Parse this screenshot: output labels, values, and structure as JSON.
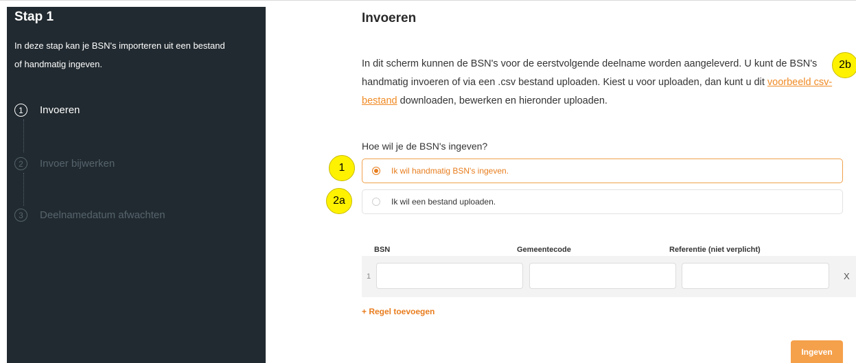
{
  "sidebar": {
    "title": "Stap 1",
    "desc_line1": "In deze stap kan je BSN's importeren uit een bestand",
    "desc_line2": "of handmatig ingeven.",
    "steps": [
      {
        "num": "1",
        "label": "Invoeren",
        "state": "active"
      },
      {
        "num": "2",
        "label": "Invoer bijwerken",
        "state": "inactive"
      },
      {
        "num": "3",
        "label": "Deelnamedatum afwachten",
        "state": "inactive"
      }
    ]
  },
  "main": {
    "title": "Invoeren",
    "intro_part1": "In dit scherm kunnen de BSN's voor de eerstvolgende deelname worden aangeleverd. U kunt de BSN's handmatig invoeren of via een .csv bestand uploaden. Kiest u voor uploaden, dan kunt u dit ",
    "intro_link": "voorbeeld csv-bestand",
    "intro_part2": " downloaden, bewerken en hieronder uploaden.",
    "question": "Hoe wil je de BSN's ingeven?",
    "options": [
      {
        "label": "Ik wil handmatig BSN's ingeven.",
        "selected": true
      },
      {
        "label": "Ik wil een bestand uploaden.",
        "selected": false
      }
    ],
    "table": {
      "headers": [
        "BSN",
        "Gemeentecode",
        "Referentie (niet verplicht)"
      ],
      "rows": [
        {
          "index": "1",
          "bsn": "",
          "gemeentecode": "",
          "referentie": "",
          "delete": "X"
        }
      ]
    },
    "add_line": "+ Regel toevoegen",
    "submit": "Ingeven"
  },
  "annotations": [
    "1",
    "2a",
    "2b"
  ],
  "colors": {
    "sidebar_bg": "#212a30",
    "accent": "#e87d1e",
    "badge": "#fff200"
  }
}
